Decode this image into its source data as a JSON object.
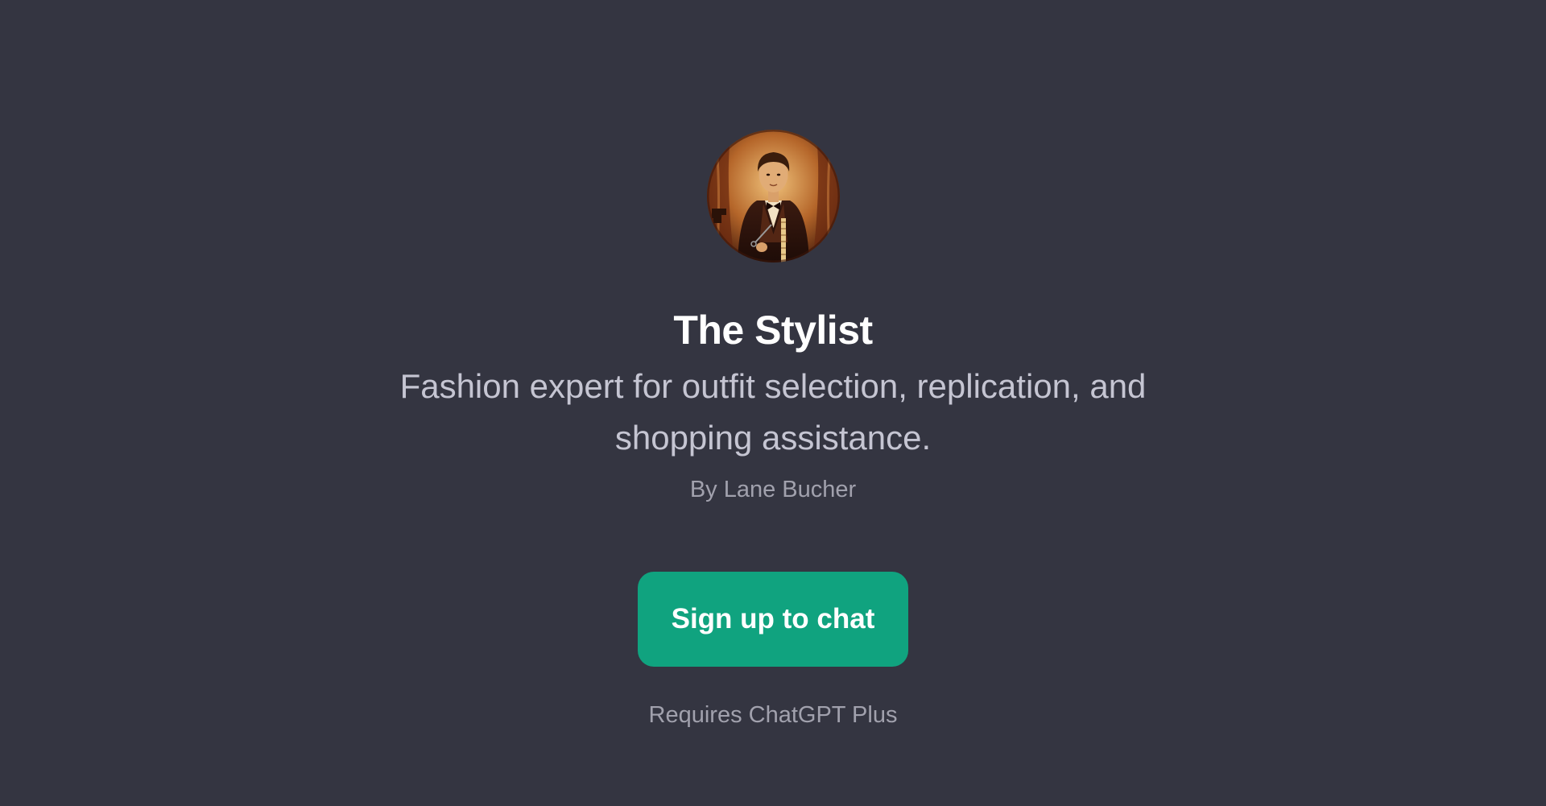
{
  "gpt": {
    "name": "The Stylist",
    "description": "Fashion expert for outfit selection, replication, and shopping assistance.",
    "author": "By Lane Bucher",
    "avatar_icon": "tailor-portrait-avatar"
  },
  "actions": {
    "signup_label": "Sign up to chat",
    "requirement_note": "Requires ChatGPT Plus"
  },
  "colors": {
    "background": "#343541",
    "title": "#ffffff",
    "description": "#c5c5d2",
    "muted": "#a1a1ad",
    "accent": "#10a37f"
  }
}
